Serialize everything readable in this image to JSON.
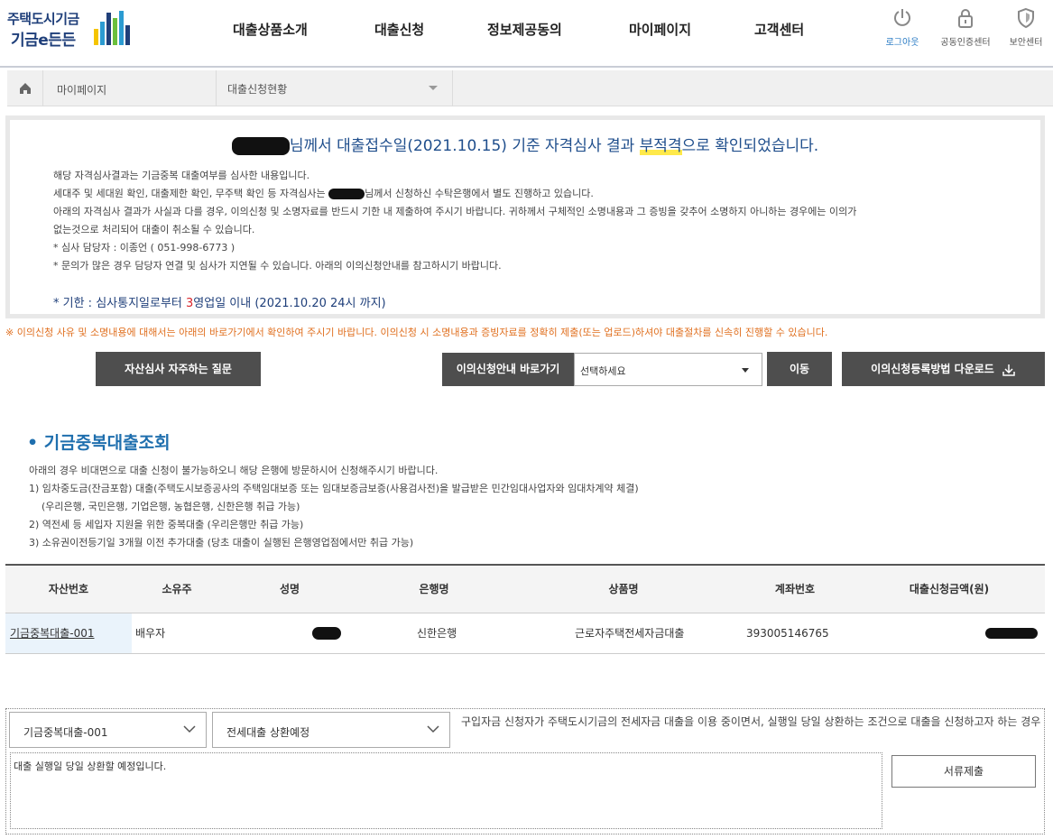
{
  "brand": {
    "line1": "주택도시기금",
    "line2": "기금e든든",
    "colors": [
      "#f5c400",
      "#2b9bd1",
      "#6bbf3c",
      "#1f3f7a"
    ]
  },
  "nav": {
    "items": [
      "대출상품소개",
      "대출신청",
      "정보제공동의",
      "마이페이지",
      "고객센터"
    ]
  },
  "utility": {
    "logout": "로그아웃",
    "cert": "공동인증센터",
    "security": "보안센터"
  },
  "breadcrumb": {
    "level1": "마이페이지",
    "level2": "대출신청현황"
  },
  "result": {
    "headline_pre": "님께서 대출접수일(2021.10.15) 기준 자격심사 결과 ",
    "headline_highlight": "부적격",
    "headline_post": "으로 확인되었습니다.",
    "line1": "해당 자격심사결과는 기금중복 대출여부를 심사한 내용입니다.",
    "line2_pre": "세대주 및 세대원 확인, 대출제한 확인, 무주택 확인 등 자격심사는 ",
    "line2_post": "님께서 신청하신 수탁은행에서 별도 진행하고 있습니다.",
    "line3": "아래의 자격심사 결과가 사실과 다를 경우, 이의신청 및 소명자료를 반드시 기한 내 제출하여 주시기 바랍니다. 귀하께서 구체적인 소명내용과 그 증빙을 갖추어 소명하지 아니하는 경우에는 이의가",
    "line4": "없는것으로 처리되어 대출이 취소될 수 있습니다.",
    "line5": "* 심사 담당자 : 이종언 ( 051-998-6773 )",
    "line6": "* 문의가 많은 경우 담당자 연결 및 심사가 지연될 수 있습니다. 아래의 이의신청안내를 참고하시기 바랍니다.",
    "deadline_pre": "* 기한 : 심사통지일로부터 ",
    "deadline_num": "3",
    "deadline_post": "영업일 이내 (2021.10.20 24시 까지)"
  },
  "notice": "※ 이의신청 사유 및 소명내용에 대해서는 아래의 바로가기에서 확인하여 주시기 바랍니다. 이의신청 시 소명내용과 증빙자료를 정확히 제출(또는 업로드)하셔야 대출절차를 신속히 진행할 수 있습니다.",
  "actions": {
    "faq": "자산심사 자주하는 질문",
    "guide_label": "이의신청안내 바로가기",
    "guide_select": "선택하세요",
    "go": "이동",
    "download": "이의신청등록방법 다운로드"
  },
  "section": {
    "title": "• 기금중복대출조회",
    "intro": "아래의 경우 비대면으로 대출 신청이 불가능하오니 해당 은행에 방문하시어 신청해주시기 바랍니다.",
    "item1": "1) 임차중도금(잔금포함) 대출(주택도시보증공사의 주택임대보증 또는 임대보증금보증(사용검사전)을 발급받은 민간임대사업자와 임대차계약 체결)",
    "item1b": "(우리은행, 국민은행, 기업은행, 농협은행, 신한은행 취급 가능)",
    "item2": "2) 역전세 등 세입자 지원을 위한 중복대출 (우리은행만 취급 가능)",
    "item3": "3) 소유권이전등기일 3개월 이전 추가대출 (당초 대출이 실행된 은행영업점에서만 취급 가능)"
  },
  "table": {
    "headers": [
      "자산번호",
      "소유주",
      "성명",
      "은행명",
      "상품명",
      "계좌번호",
      "대출신청금액(원)"
    ],
    "row": {
      "asset": "기금중복대출-001",
      "owner": "배우자",
      "bank": "신한은행",
      "product": "근로자주택전세자금대출",
      "account": "393005146765"
    }
  },
  "form": {
    "asset_select": "기금중복대출-001",
    "type_select": "전세대출 상환예정",
    "description": "구입자금 신청자가 주택도시기금의 전세자금 대출을 이용 중이면서, 실행일 당일 상환하는 조건으로 대출을 신청하고자 하는 경우",
    "memo": "대출 실행일 당일 상환할 예정입니다.",
    "submit": "서류제출"
  }
}
